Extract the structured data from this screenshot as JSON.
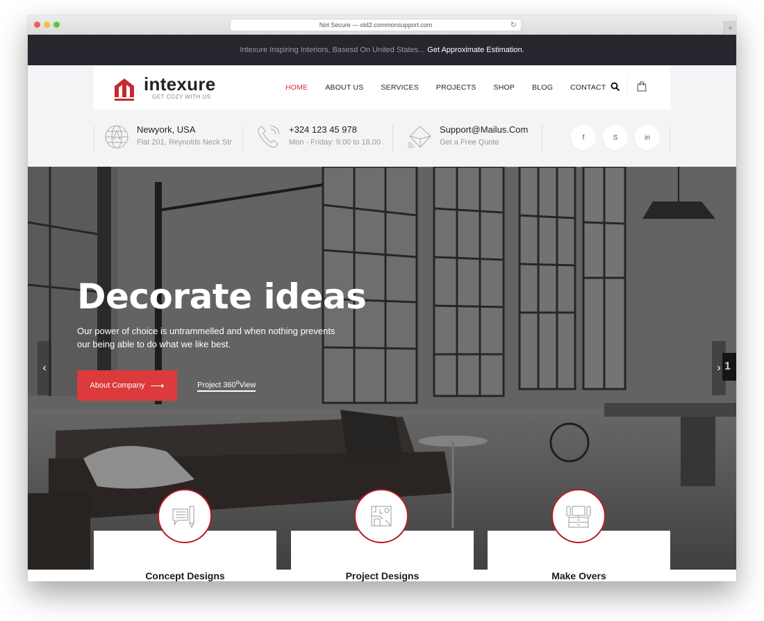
{
  "browser": {
    "url_text": "Not Secure — old2.commonsupport.com",
    "reload_icon": "reload-icon",
    "new_tab_label": "+"
  },
  "topbar": {
    "text": "Intexure Inspiring Interiors, Basesd On United States...",
    "cta": "Get Approximate Estimation."
  },
  "logo": {
    "name": "intexure",
    "tagline": "GET COZY WITH US",
    "icon": "house-icon"
  },
  "nav": {
    "items": [
      {
        "label": "HOME",
        "active": true
      },
      {
        "label": "ABOUT US",
        "active": false
      },
      {
        "label": "SERVICES",
        "active": false
      },
      {
        "label": "PROJECTS",
        "active": false
      },
      {
        "label": "SHOP",
        "active": false
      },
      {
        "label": "BLOG",
        "active": false
      },
      {
        "label": "CONTACT",
        "active": false
      }
    ],
    "search_icon": "search-icon",
    "cart_icon": "shopping-bag-icon"
  },
  "contact": {
    "location": {
      "title": "Newyork, USA",
      "sub": "Flat 201, Reynolds Neck Str",
      "icon": "globe-icon"
    },
    "phone": {
      "title": "+324 123 45 978",
      "sub": "Mon - Friday: 9.00 to 18.00",
      "icon": "phone-icon"
    },
    "email": {
      "title": "Support@Mailus.Com",
      "sub": "Get a Free Quote",
      "icon": "envelope-icon"
    },
    "social": [
      {
        "label": "f",
        "icon": "facebook-icon"
      },
      {
        "label": "S",
        "icon": "skype-icon"
      },
      {
        "label": "in",
        "icon": "linkedin-icon"
      }
    ]
  },
  "hero": {
    "title": "Decorate ideas",
    "text": "Our power of choice is untrammelled and when nothing prevents our being able to do what we like best.",
    "primary_button": "About Company",
    "primary_arrow": "⟶",
    "secondary_link": "Project 360",
    "secondary_sup": "o",
    "secondary_suffix": "View",
    "prev": "‹",
    "next": "›",
    "slide_number": "1"
  },
  "features": [
    {
      "title": "Concept Designs",
      "icon": "concept-design-icon"
    },
    {
      "title": "Project Designs",
      "icon": "floor-plan-icon"
    },
    {
      "title": "Make Overs",
      "icon": "tv-cabinet-icon"
    }
  ],
  "colors": {
    "accent": "#dc3a3d",
    "accent_dark": "#b71c22",
    "topbar_bg": "#26262e",
    "header_bg": "#f4f4f6"
  }
}
